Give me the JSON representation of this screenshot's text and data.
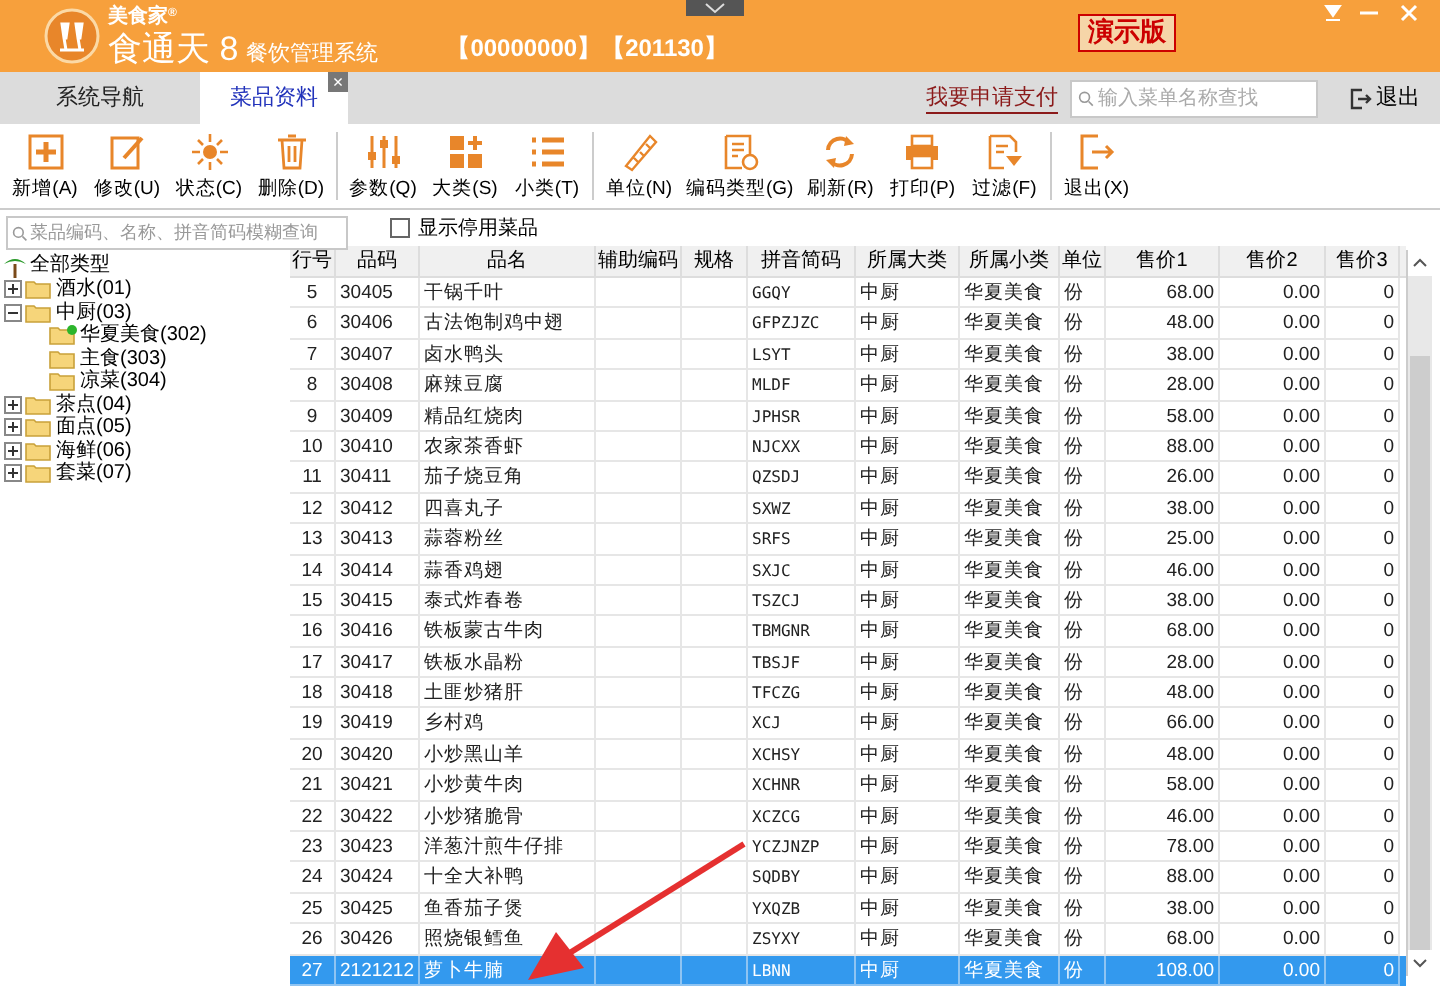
{
  "header": {
    "brand": "美食家",
    "brand_mark": "®",
    "product": "食通天 8",
    "subtitle": "餐饮管理系统",
    "account": "【00000000】【201130】",
    "edition": "演示版"
  },
  "tabs": [
    {
      "label": "系统导航",
      "selected": false
    },
    {
      "label": "菜品资料",
      "selected": true,
      "close": "×"
    }
  ],
  "pay_link": "我要申请支付",
  "menu_search": {
    "placeholder": "输入菜单名称查找"
  },
  "exit_button": "退出",
  "toolbar": [
    "新增(A)",
    "修改(U)",
    "状态(C)",
    "删除(D)",
    "参数(Q)",
    "大类(S)",
    "小类(T)",
    "单位(N)",
    "编码类型(G)",
    "刷新(R)",
    "打印(P)",
    "过滤(F)",
    "退出(X)"
  ],
  "item_search": {
    "placeholder": "菜品编码、名称、拼音简码模糊查询"
  },
  "show_disabled": {
    "label": "显示停用菜品",
    "checked": false
  },
  "tree": {
    "label": "全部类型",
    "children": [
      {
        "label": "酒水(01)",
        "expanded": false
      },
      {
        "label": "中厨(03)",
        "expanded": true,
        "children": [
          {
            "label": "华夏美食(302)",
            "selected": true
          },
          {
            "label": "主食(303)",
            "selected": false
          },
          {
            "label": "凉菜(304)",
            "selected": false
          }
        ]
      },
      {
        "label": "茶点(04)",
        "expanded": false
      },
      {
        "label": "面点(05)",
        "expanded": false
      },
      {
        "label": "海鲜(06)",
        "expanded": false
      },
      {
        "label": "套菜(07)",
        "expanded": false
      }
    ]
  },
  "table": {
    "columns": [
      "行号",
      "品码",
      "品名",
      "辅助编码",
      "规格",
      "拼音简码",
      "所属大类",
      "所属小类",
      "单位",
      "售价1",
      "售价2",
      "售价3"
    ],
    "rows": [
      {
        "cells": [
          "5",
          "30405",
          "干锅千叶",
          "",
          "",
          "GGQY",
          "中厨",
          "华夏美食",
          "份",
          "68.00",
          "0.00",
          "0"
        ],
        "selected": false
      },
      {
        "cells": [
          "6",
          "30406",
          "古法饱制鸡中翅",
          "",
          "",
          "GFPZJZC",
          "中厨",
          "华夏美食",
          "份",
          "48.00",
          "0.00",
          "0"
        ],
        "selected": false
      },
      {
        "cells": [
          "7",
          "30407",
          "卤水鸭头",
          "",
          "",
          "LSYT",
          "中厨",
          "华夏美食",
          "份",
          "38.00",
          "0.00",
          "0"
        ],
        "selected": false
      },
      {
        "cells": [
          "8",
          "30408",
          "麻辣豆腐",
          "",
          "",
          "MLDF",
          "中厨",
          "华夏美食",
          "份",
          "28.00",
          "0.00",
          "0"
        ],
        "selected": false
      },
      {
        "cells": [
          "9",
          "30409",
          "精品红烧肉",
          "",
          "",
          "JPHSR",
          "中厨",
          "华夏美食",
          "份",
          "58.00",
          "0.00",
          "0"
        ],
        "selected": false
      },
      {
        "cells": [
          "10",
          "30410",
          "农家茶香虾",
          "",
          "",
          "NJCXX",
          "中厨",
          "华夏美食",
          "份",
          "88.00",
          "0.00",
          "0"
        ],
        "selected": false
      },
      {
        "cells": [
          "11",
          "30411",
          "茄子烧豆角",
          "",
          "",
          "QZSDJ",
          "中厨",
          "华夏美食",
          "份",
          "26.00",
          "0.00",
          "0"
        ],
        "selected": false
      },
      {
        "cells": [
          "12",
          "30412",
          "四喜丸子",
          "",
          "",
          "SXWZ",
          "中厨",
          "华夏美食",
          "份",
          "38.00",
          "0.00",
          "0"
        ],
        "selected": false
      },
      {
        "cells": [
          "13",
          "30413",
          "蒜蓉粉丝",
          "",
          "",
          "SRFS",
          "中厨",
          "华夏美食",
          "份",
          "25.00",
          "0.00",
          "0"
        ],
        "selected": false
      },
      {
        "cells": [
          "14",
          "30414",
          "蒜香鸡翅",
          "",
          "",
          "SXJC",
          "中厨",
          "华夏美食",
          "份",
          "46.00",
          "0.00",
          "0"
        ],
        "selected": false
      },
      {
        "cells": [
          "15",
          "30415",
          "泰式炸春卷",
          "",
          "",
          "TSZCJ",
          "中厨",
          "华夏美食",
          "份",
          "38.00",
          "0.00",
          "0"
        ],
        "selected": false
      },
      {
        "cells": [
          "16",
          "30416",
          "铁板蒙古牛肉",
          "",
          "",
          "TBMGNR",
          "中厨",
          "华夏美食",
          "份",
          "68.00",
          "0.00",
          "0"
        ],
        "selected": false
      },
      {
        "cells": [
          "17",
          "30417",
          "铁板水晶粉",
          "",
          "",
          "TBSJF",
          "中厨",
          "华夏美食",
          "份",
          "28.00",
          "0.00",
          "0"
        ],
        "selected": false
      },
      {
        "cells": [
          "18",
          "30418",
          "土匪炒猪肝",
          "",
          "",
          "TFCZG",
          "中厨",
          "华夏美食",
          "份",
          "48.00",
          "0.00",
          "0"
        ],
        "selected": false
      },
      {
        "cells": [
          "19",
          "30419",
          "乡村鸡",
          "",
          "",
          "XCJ",
          "中厨",
          "华夏美食",
          "份",
          "66.00",
          "0.00",
          "0"
        ],
        "selected": false
      },
      {
        "cells": [
          "20",
          "30420",
          "小炒黑山羊",
          "",
          "",
          "XCHSY",
          "中厨",
          "华夏美食",
          "份",
          "48.00",
          "0.00",
          "0"
        ],
        "selected": false
      },
      {
        "cells": [
          "21",
          "30421",
          "小炒黄牛肉",
          "",
          "",
          "XCHNR",
          "中厨",
          "华夏美食",
          "份",
          "58.00",
          "0.00",
          "0"
        ],
        "selected": false
      },
      {
        "cells": [
          "22",
          "30422",
          "小炒猪脆骨",
          "",
          "",
          "XCZCG",
          "中厨",
          "华夏美食",
          "份",
          "46.00",
          "0.00",
          "0"
        ],
        "selected": false
      },
      {
        "cells": [
          "23",
          "30423",
          "洋葱汁煎牛仔排",
          "",
          "",
          "YCZJNZP",
          "中厨",
          "华夏美食",
          "份",
          "78.00",
          "0.00",
          "0"
        ],
        "selected": false
      },
      {
        "cells": [
          "24",
          "30424",
          "十全大补鸭",
          "",
          "",
          "SQDBY",
          "中厨",
          "华夏美食",
          "份",
          "88.00",
          "0.00",
          "0"
        ],
        "selected": false
      },
      {
        "cells": [
          "25",
          "30425",
          "鱼香茄子煲",
          "",
          "",
          "YXQZB",
          "中厨",
          "华夏美食",
          "份",
          "38.00",
          "0.00",
          "0"
        ],
        "selected": false
      },
      {
        "cells": [
          "26",
          "30426",
          "照烧银鳕鱼",
          "",
          "",
          "ZSYXY",
          "中厨",
          "华夏美食",
          "份",
          "68.00",
          "0.00",
          "0"
        ],
        "selected": false
      },
      {
        "cells": [
          "27",
          "2121212",
          "萝卜牛腩",
          "",
          "",
          "LBNN",
          "中厨",
          "华夏美食",
          "份",
          "108.00",
          "0.00",
          "0"
        ],
        "selected": true
      }
    ]
  }
}
